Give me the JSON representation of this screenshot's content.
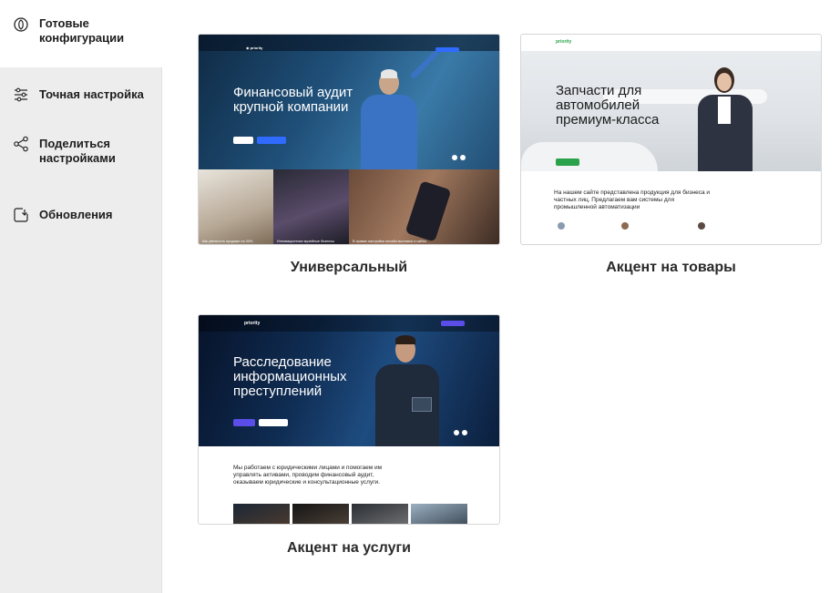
{
  "sidebar": {
    "items": [
      {
        "label": "Готовые конфигурации",
        "icon": "configurations-icon"
      },
      {
        "label": "Точная настройка",
        "icon": "sliders-icon"
      },
      {
        "label": "Поделиться настройками",
        "icon": "share-icon"
      },
      {
        "label": "Обновления",
        "icon": "update-icon"
      }
    ]
  },
  "cards": [
    {
      "title": "Универсальный",
      "preview": {
        "hero_title": "Финансовый аудит крупной компании",
        "tiles": [
          "Как увеличить продажи на 30%",
          "Инновационные музейные бизнесы",
          "В правах настройки онлайн-выставок и сайты"
        ]
      }
    },
    {
      "title": "Акцент на товары",
      "preview": {
        "logo": "priority",
        "hero_title": "Запчасти для автомобилей премиум-класса",
        "body_text": "На нашем сайте представлена продукция для бизнеса и частных лиц. Предлагаем вам системы для промышленной автоматизации"
      }
    },
    {
      "title": "Акцент на услуги",
      "preview": {
        "logo": "priority",
        "hero_title": "Расследование информационных преступлений",
        "body_text": "Мы работаем с юридическими лицами и помогаем им управлять активами, проводим финансовый аудит, оказываем юридические и консультационные услуги."
      }
    }
  ],
  "colors": {
    "sidebar_bg": "#ededed",
    "accent_blue": "#2f6bff",
    "accent_green": "#2aa24b",
    "accent_purple": "#5a4de8"
  }
}
